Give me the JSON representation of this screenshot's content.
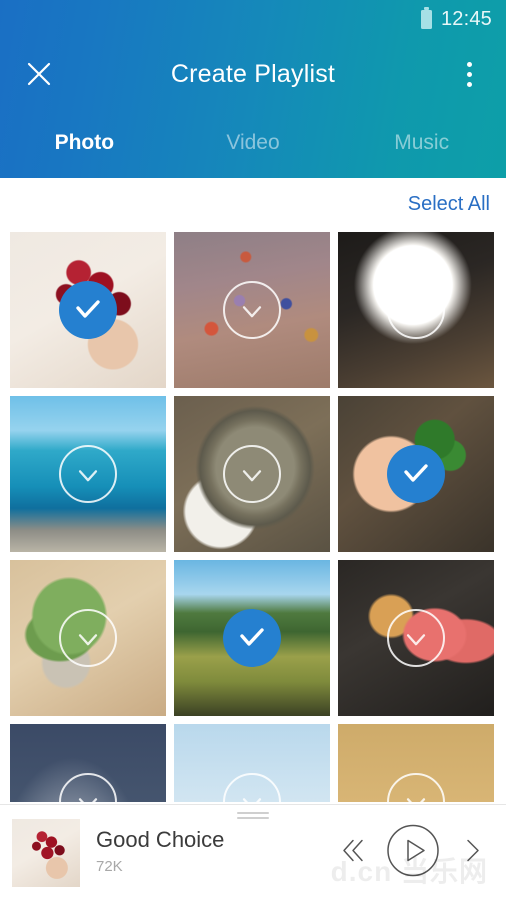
{
  "status_bar": {
    "time": "12:45",
    "battery_icon": "battery-icon"
  },
  "app_bar": {
    "title": "Create Playlist",
    "close_icon": "close-icon",
    "overflow_icon": "overflow-menu-icon"
  },
  "tabs": [
    {
      "label": "Photo",
      "active": true
    },
    {
      "label": "Video",
      "active": false
    },
    {
      "label": "Music",
      "active": false
    }
  ],
  "toolbar": {
    "select_all_label": "Select All",
    "accent_color": "#2a6fc4"
  },
  "grid": {
    "columns": 3,
    "selection_color": "#2580d0",
    "tiles": [
      {
        "name": "photo-red-flower-bouquet",
        "selected": true,
        "style": "p-flowers"
      },
      {
        "name": "photo-hot-air-balloons",
        "selected": false,
        "style": "p-balloons"
      },
      {
        "name": "photo-wall-clock",
        "selected": false,
        "style": "p-clock"
      },
      {
        "name": "photo-seaside-pier",
        "selected": false,
        "style": "p-sea"
      },
      {
        "name": "photo-shoes-on-tree-stump",
        "selected": false,
        "style": "p-wood"
      },
      {
        "name": "photo-clover-in-hand",
        "selected": true,
        "style": "p-clover"
      },
      {
        "name": "photo-potted-plant",
        "selected": false,
        "style": "p-plant"
      },
      {
        "name": "photo-riverside-field",
        "selected": true,
        "style": "p-field"
      },
      {
        "name": "photo-sushi-plate",
        "selected": false,
        "style": "p-sushi"
      },
      {
        "name": "photo-star-trails",
        "selected": false,
        "style": "p-stars"
      },
      {
        "name": "photo-sky-and-grass",
        "selected": false,
        "style": "p-sky"
      },
      {
        "name": "photo-sand-dune",
        "selected": false,
        "style": "p-sand"
      }
    ]
  },
  "player": {
    "title": "Good Choice",
    "subtitle": "72K",
    "thumbnail_name": "photo-red-flower-bouquet",
    "drag_handle": "drag-handle",
    "previous_icon": "previous-track-icon",
    "play_icon": "play-icon",
    "next_icon": "next-track-icon",
    "watermark": "d.cn 当乐网"
  }
}
